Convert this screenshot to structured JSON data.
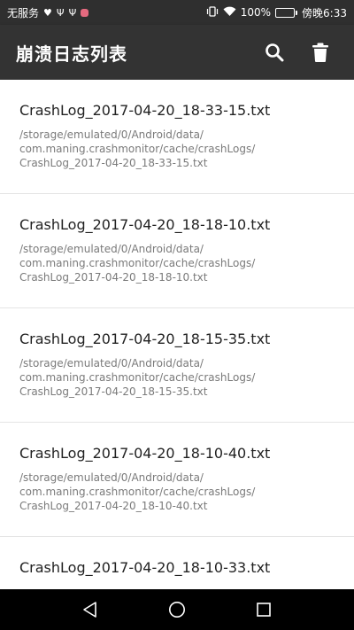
{
  "status_bar": {
    "left_text": "无服务",
    "battery_percent": "100%",
    "time": "傍晚6:33",
    "battery_level": 1.0,
    "icons": [
      "heart-icon",
      "usb-icon",
      "usb-icon",
      "app-notification-icon",
      "vibrate-icon",
      "wifi-icon",
      "battery-icon"
    ]
  },
  "app_bar": {
    "title": "崩溃日志列表",
    "icons": [
      "search-icon",
      "trash-icon"
    ]
  },
  "logs": [
    {
      "name": "CrashLog_2017-04-20_18-33-15.txt",
      "path_line1": "/storage/emulated/0/Android/data/",
      "path_line2": "com.maning.crashmonitor/cache/crashLogs/",
      "path_line3": "CrashLog_2017-04-20_18-33-15.txt"
    },
    {
      "name": "CrashLog_2017-04-20_18-18-10.txt",
      "path_line1": "/storage/emulated/0/Android/data/",
      "path_line2": "com.maning.crashmonitor/cache/crashLogs/",
      "path_line3": "CrashLog_2017-04-20_18-18-10.txt"
    },
    {
      "name": "CrashLog_2017-04-20_18-15-35.txt",
      "path_line1": "/storage/emulated/0/Android/data/",
      "path_line2": "com.maning.crashmonitor/cache/crashLogs/",
      "path_line3": "CrashLog_2017-04-20_18-15-35.txt"
    },
    {
      "name": "CrashLog_2017-04-20_18-10-40.txt",
      "path_line1": "/storage/emulated/0/Android/data/",
      "path_line2": "com.maning.crashmonitor/cache/crashLogs/",
      "path_line3": "CrashLog_2017-04-20_18-10-40.txt"
    },
    {
      "name": "CrashLog_2017-04-20_18-10-33.txt"
    }
  ],
  "nav_bar": {
    "icons": [
      "back-icon",
      "home-icon",
      "recents-icon"
    ]
  },
  "colors": {
    "status_bar_bg": "#2f2f2f",
    "app_bar_bg": "#333333",
    "nav_bar_bg": "#000000",
    "battery_fill": "#3ecf5b",
    "title_text": "#ffffff",
    "log_name_text": "#222222",
    "log_path_text": "#7a7a7a"
  }
}
